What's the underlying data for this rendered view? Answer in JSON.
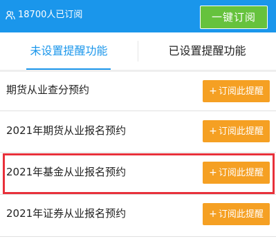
{
  "header": {
    "subscriber_count": "18700人已订阅",
    "subscribe_all_label": "一键订阅",
    "colors": {
      "bar": "#1a96eb",
      "button": "#66c23d"
    }
  },
  "tabs": [
    {
      "label": "未设置提醒功能",
      "active": true
    },
    {
      "label": "已设置提醒功能",
      "active": false
    }
  ],
  "items": [
    {
      "title": "期货从业查分预约",
      "button_label": "订阅此提醒"
    },
    {
      "title": "2021年期货从业报名预约",
      "button_label": "订阅此提醒"
    },
    {
      "title": "2021年基金从业报名预约",
      "button_label": "订阅此提醒",
      "highlighted": true
    },
    {
      "title": "2021年证券从业报名预约",
      "button_label": "订阅此提醒"
    }
  ],
  "colors": {
    "accent": "#1a96eb",
    "remind_button": "#f5a023",
    "highlight_border": "#e8303a"
  },
  "icons": {
    "subscriber": "users-icon",
    "plus": "plus-icon"
  }
}
